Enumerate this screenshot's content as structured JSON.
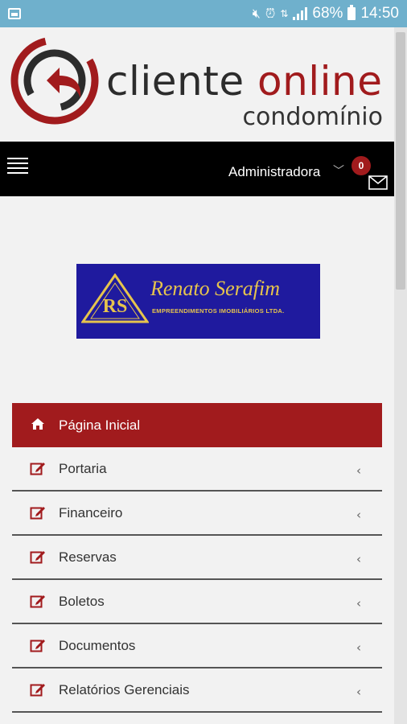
{
  "status_bar": {
    "battery_percent": "68%",
    "time": "14:50",
    "icons": [
      "image-icon",
      "mute-icon",
      "alarm-icon",
      "data-icon",
      "signal-icon",
      "battery-icon"
    ]
  },
  "header": {
    "brand_main": "cliente ",
    "brand_accent": "online",
    "brand_sub": "condomínio",
    "logo_icon": "back-arrow-circle-logo"
  },
  "navbar": {
    "menu_icon": "hamburger-icon",
    "user_label": "Administradora",
    "chevron": "﹀",
    "notification_count": "0",
    "mail_icon": "mail-icon"
  },
  "company_logo": {
    "name": "Renato Serafim",
    "tagline": "EMPREENDIMENTOS IMOBILIÁRIOS LTDA.",
    "initials": "RS"
  },
  "menu": {
    "items": [
      {
        "label": "Página Inicial",
        "icon": "home-icon",
        "active": true
      },
      {
        "label": "Portaria",
        "icon": "edit-icon",
        "chevron": "‹"
      },
      {
        "label": "Financeiro",
        "icon": "edit-icon",
        "chevron": "‹"
      },
      {
        "label": "Reservas",
        "icon": "edit-icon",
        "chevron": "‹"
      },
      {
        "label": "Boletos",
        "icon": "edit-icon",
        "chevron": "‹"
      },
      {
        "label": "Documentos",
        "icon": "edit-icon",
        "chevron": "‹"
      },
      {
        "label": "Relatórios Gerenciais",
        "icon": "edit-icon",
        "chevron": "‹"
      }
    ]
  },
  "colors": {
    "accent": "#a11b1d",
    "navbar": "#000000",
    "status_bar": "#6fb0cc",
    "company_bg": "#1f1a9e",
    "company_gold": "#e6c44d"
  }
}
